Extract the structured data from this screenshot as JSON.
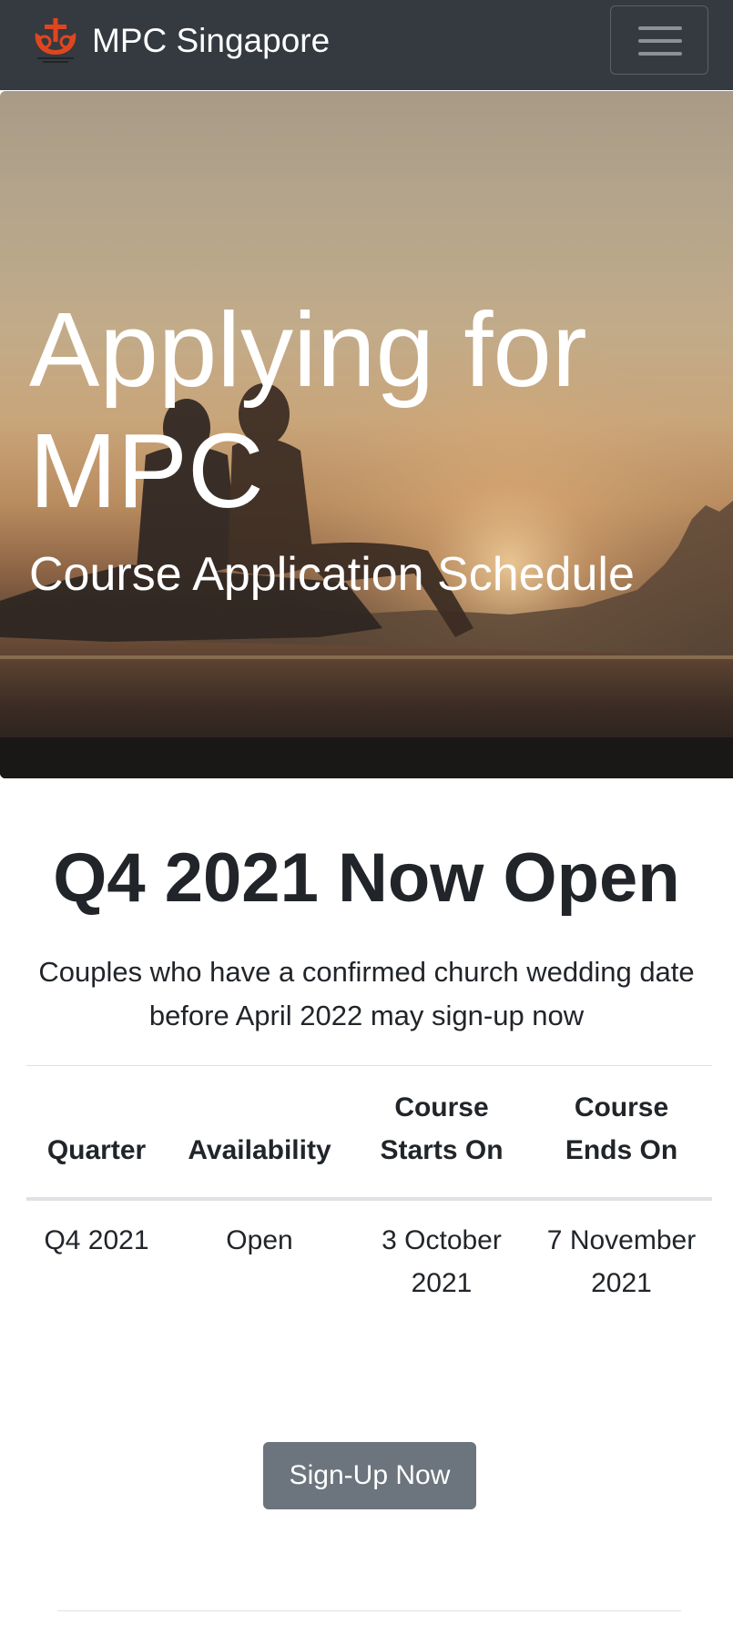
{
  "navbar": {
    "brand_name": "MPC Singapore",
    "logo_icon": "church-anchor-logo-icon",
    "logo_tagline": "Two Came In Unison",
    "menu_icon": "hamburger-menu-icon"
  },
  "hero": {
    "title": "Applying for MPC",
    "subtitle": "Course Application Schedule"
  },
  "main": {
    "heading": "Q4 2021 Now Open",
    "lead": "Couples who have a confirmed church wedding date before April 2022 may sign-up now",
    "table": {
      "headers": [
        "Quarter",
        "Availability",
        "Course Starts On",
        "Course Ends On"
      ],
      "rows": [
        [
          "Q4 2021",
          "Open",
          "3 October 2021",
          "7 November 2021"
        ]
      ]
    },
    "signup_label": "Sign-Up Now"
  },
  "colors": {
    "navbar_bg": "#343a40",
    "logo_accent": "#e0461e",
    "button_bg": "#6c757d",
    "text": "#212529"
  }
}
